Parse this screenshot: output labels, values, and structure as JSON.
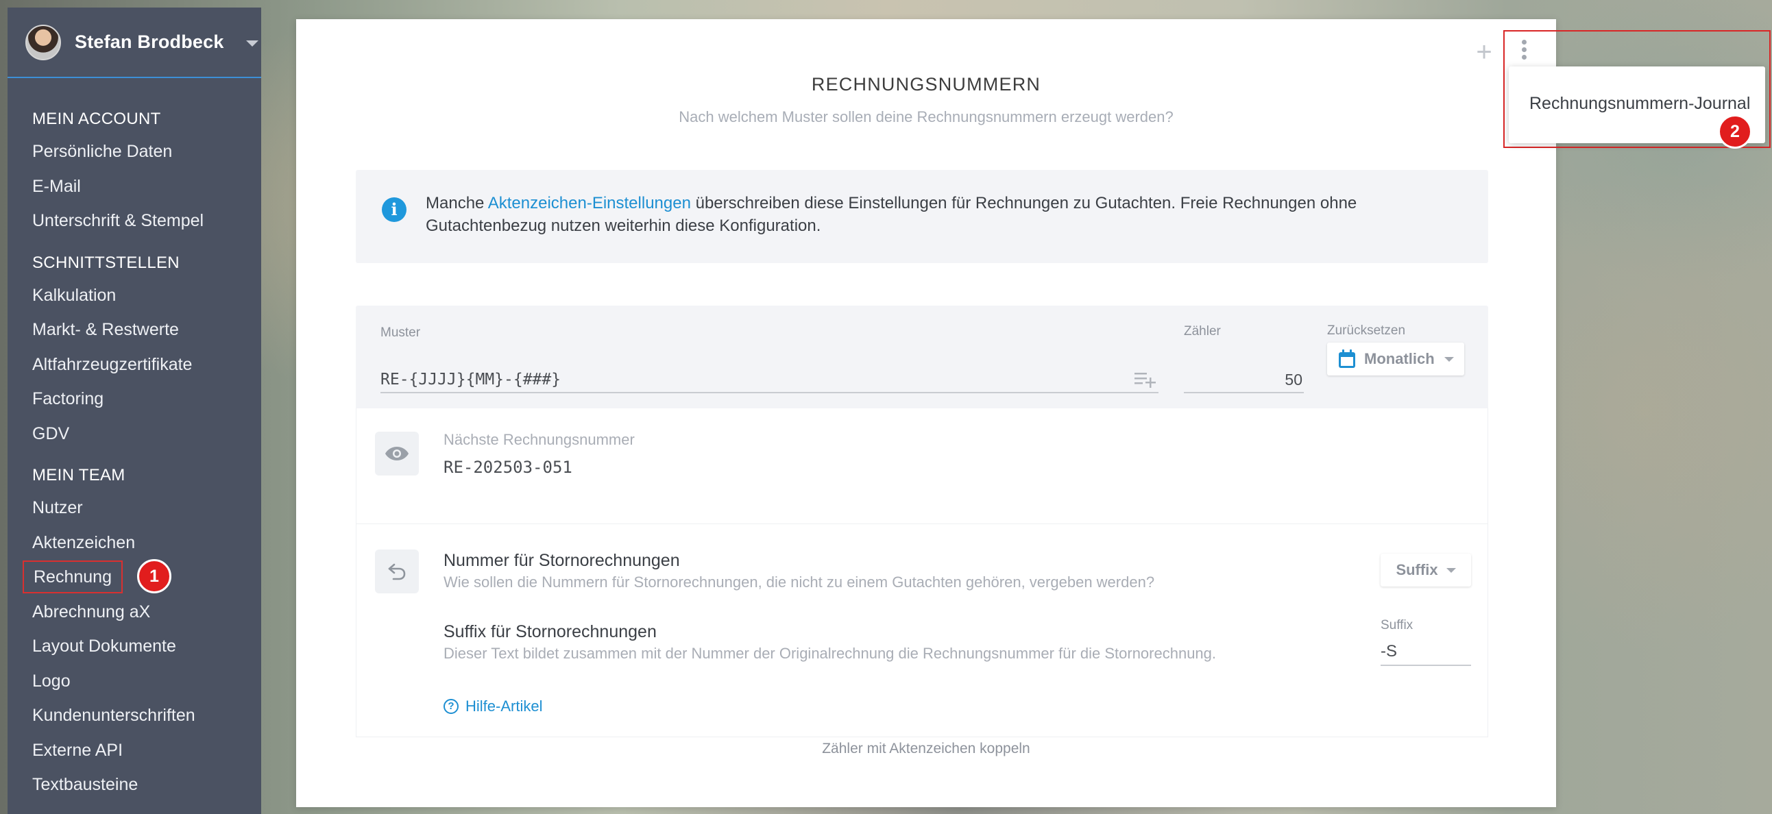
{
  "user": {
    "name": "Stefan Brodbeck"
  },
  "sidebar": {
    "sections": [
      {
        "title": "MEIN ACCOUNT",
        "items": [
          "Persönliche Daten",
          "E-Mail",
          "Unterschrift & Stempel"
        ]
      },
      {
        "title": "SCHNITTSTELLEN",
        "items": [
          "Kalkulation",
          "Markt- & Restwerte",
          "Altfahrzeugzertifikate",
          "Factoring",
          "GDV"
        ]
      },
      {
        "title": "MEIN TEAM",
        "items": [
          "Nutzer",
          "Aktenzeichen",
          "Rechnung",
          "Abrechnung aX",
          "Layout Dokumente",
          "Logo",
          "Kundenunterschriften",
          "Externe API",
          "Textbausteine"
        ]
      }
    ],
    "active_item": "Rechnung"
  },
  "badges": {
    "one": "1",
    "two": "2"
  },
  "card": {
    "title": "RECHNUNGSNUMMERN",
    "subtitle": "Nach welchem Muster sollen deine Rechnungsnummern erzeugt werden?",
    "info": {
      "prefix": "Manche ",
      "link": "Aktenzeichen-Einstellungen",
      "suffix": " überschreiben diese Einstellungen für Rechnungen zu Gutachten. Freie Rechnungen ohne Gutachtenbezug nutzen weiterhin diese Konfiguration."
    },
    "pattern": {
      "muster_label": "Muster",
      "muster_value": "RE-{JJJJ}{MM}-{###}",
      "counter_label": "Zähler",
      "counter_value": "50",
      "reset_label": "Zurücksetzen",
      "reset_value": "Monatlich"
    },
    "next": {
      "label": "Nächste Rechnungsnummer",
      "value": "RE-202503-051"
    },
    "storno": {
      "title": "Nummer für Stornorechnungen",
      "desc": "Wie sollen die Nummern für Stornorechnungen, die nicht zu einem Gutachten gehören, vergeben werden?",
      "select_value": "Suffix"
    },
    "suffix": {
      "title": "Suffix für Stornorechnungen",
      "desc": "Dieser Text bildet zusammen mit der Nummer der Originalrechnung die Rechnungsnummer für die Stornorechnung.",
      "label": "Suffix",
      "value": "-S"
    },
    "help_link": "Hilfe-Artikel",
    "bottom_link": "Zähler mit Aktenzeichen koppeln"
  },
  "menu": {
    "items": [
      "Rechnungsnummern-Journal"
    ]
  },
  "colors": {
    "sidebar": "#4b5262",
    "accent": "#1d8fd2",
    "highlight": "#d92626"
  }
}
